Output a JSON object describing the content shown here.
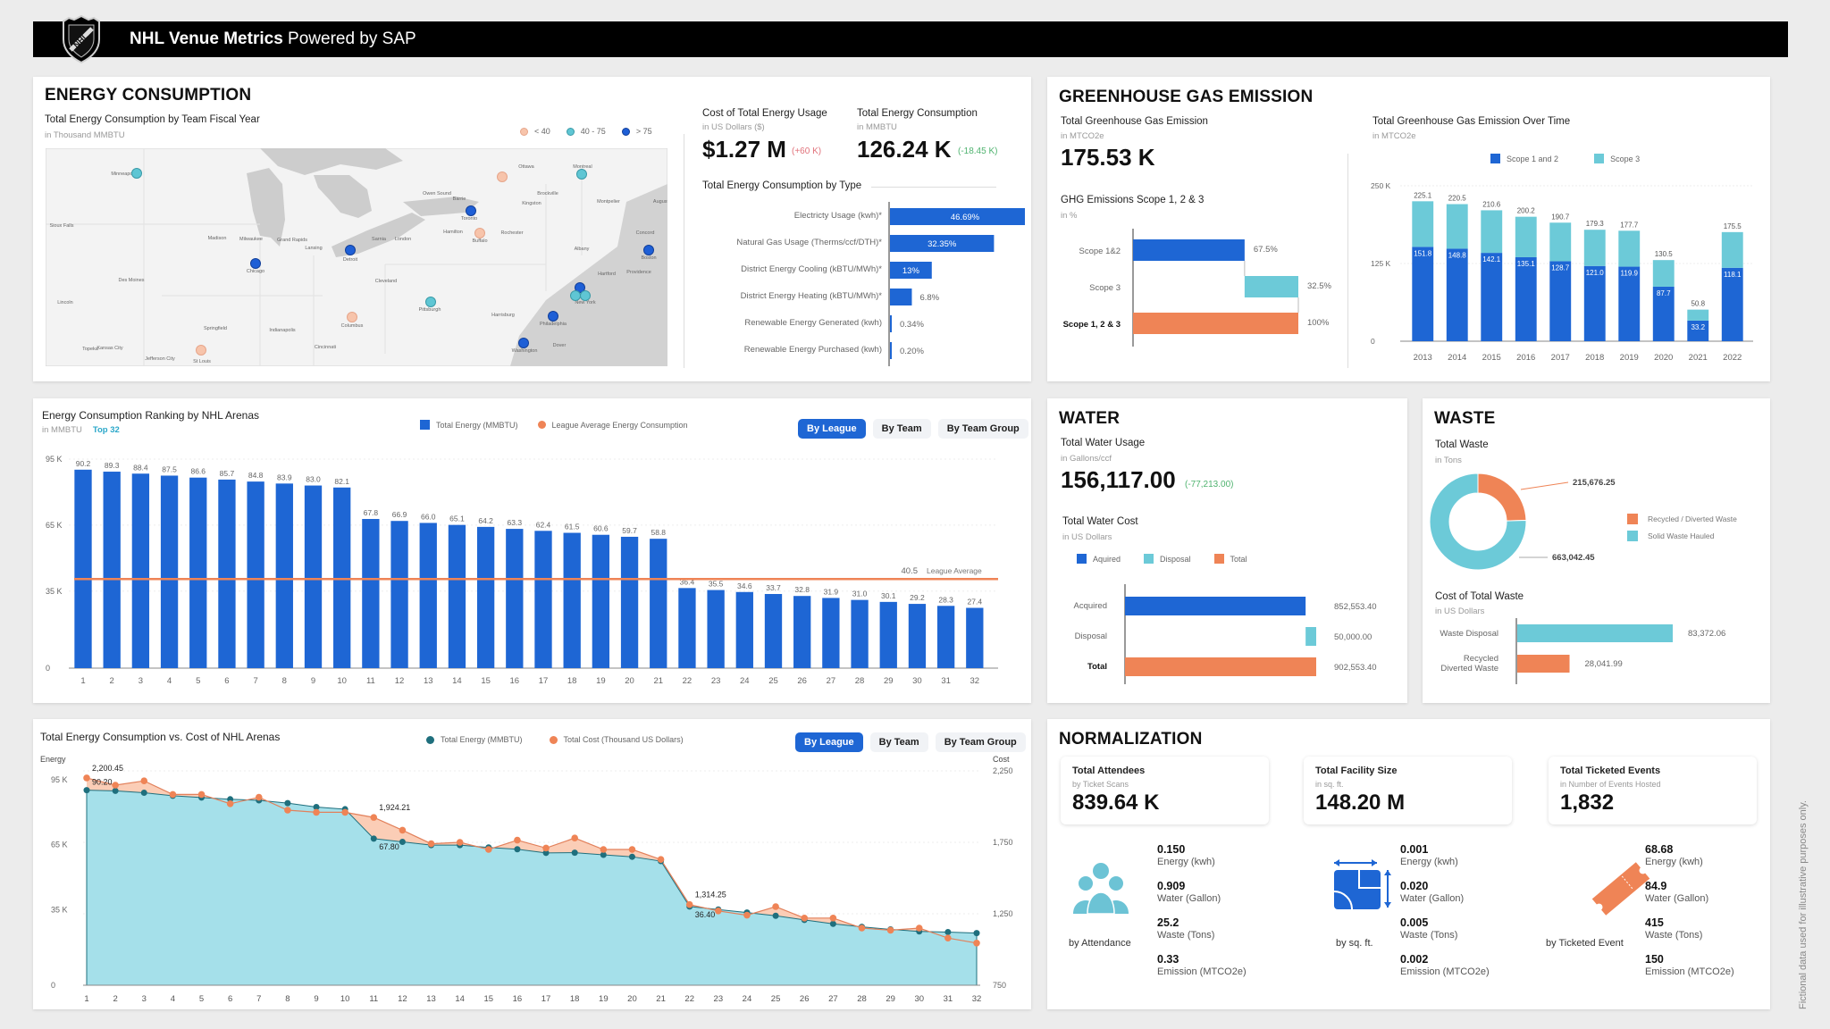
{
  "header": {
    "title_bold": "NHL Venue Metrics",
    "title_rest": " Powered by SAP",
    "logo": "nhl-shield-logo"
  },
  "energy": {
    "section_title": "ENERGY CONSUMPTION",
    "map": {
      "title": "Total Energy Consumption by Team Fiscal Year",
      "unit": "in Thousand MMBTU",
      "legend": [
        {
          "label": "< 40",
          "color": "#f7c4ab"
        },
        {
          "label": "40 - 75",
          "color": "#5fc6d4"
        },
        {
          "label": "> 75",
          "color": "#1e5fd6"
        }
      ],
      "markers": [
        {
          "city": "Minneapolis",
          "tier": "40 - 75"
        },
        {
          "city": "Chicago",
          "tier": "> 75"
        },
        {
          "city": "Detroit",
          "tier": "> 75"
        },
        {
          "city": "Toronto",
          "tier": "> 75"
        },
        {
          "city": "Buffalo",
          "tier": "< 40"
        },
        {
          "city": "Ottawa",
          "tier": "< 40"
        },
        {
          "city": "Montreal",
          "tier": "40 - 75"
        },
        {
          "city": "Boston",
          "tier": "> 75"
        },
        {
          "city": "New York",
          "tier": "> 75"
        },
        {
          "city": "New York",
          "tier": "40 - 75"
        },
        {
          "city": "New York",
          "tier": "40 - 75"
        },
        {
          "city": "Philadelphia",
          "tier": "> 75"
        },
        {
          "city": "Washington",
          "tier": "> 75"
        },
        {
          "city": "Pittsburgh",
          "tier": "40 - 75"
        },
        {
          "city": "Columbus",
          "tier": "< 40"
        },
        {
          "city": "St Louis",
          "tier": "< 40"
        }
      ],
      "place_labels": [
        "Minneapolis",
        "Sioux Falls",
        "Madison",
        "Milwaukee",
        "Grand Rapids",
        "Lansing",
        "Detroit",
        "Chicago",
        "Des Moines",
        "Lincoln",
        "Springfield",
        "Indianapolis",
        "Columbus",
        "Cincinnati",
        "Topeka",
        "Kansas City",
        "Jefferson City",
        "St Louis",
        "Toronto",
        "Hamilton",
        "Buffalo",
        "Rochester",
        "Ottawa",
        "Montreal",
        "Montpelier",
        "Augusta",
        "Concord",
        "Albany",
        "Boston",
        "Hartford",
        "Providence",
        "New York",
        "Philadelphia",
        "Harrisburg",
        "Pittsburgh",
        "Cleveland",
        "Washington",
        "Dover",
        "London",
        "Sarnia",
        "Barrie",
        "Kingston",
        "Brockville",
        "Owen Sound"
      ]
    },
    "cost_kpi": {
      "title": "Cost of Total Energy Usage",
      "unit": "in US Dollars ($)",
      "value": "$1.27 M",
      "delta": "(+60 K)"
    },
    "consumption_kpi": {
      "title": "Total Energy Consumption",
      "unit": "in MMBTU",
      "value": "126.24 K",
      "delta": "(-18.45 K)"
    },
    "by_type": {
      "title": "Total Energy Consumption by Type",
      "items": [
        {
          "label": "Electricty Usage (kwh)*",
          "value": 46.69,
          "display": "46.69%"
        },
        {
          "label": "Natural Gas Usage (Therms/ccf/DTH)*",
          "value": 32.35,
          "display": "32.35%"
        },
        {
          "label": "District Energy Cooling (kBTU/MWh)*",
          "value": 13,
          "display": "13%"
        },
        {
          "label": "District Energy Heating (kBTU/MWh)*",
          "value": 6.8,
          "display": "6.8%"
        },
        {
          "label": "Renewable Energy Generated (kwh)",
          "value": 0.34,
          "display": "0.34%"
        },
        {
          "label": "Renewable Energy Purchased (kwh)",
          "value": 0.2,
          "display": "0.20%"
        }
      ]
    }
  },
  "ghg": {
    "section_title": "GREENHOUSE GAS EMISSION",
    "kpi": {
      "title": "Total Greenhouse Gas Emission",
      "unit": "in MTCO2e",
      "value": "175.53 K"
    },
    "scopes": {
      "title": "GHG Emissions Scope 1, 2 & 3",
      "unit": "in %",
      "items": [
        {
          "label": "Scope 1&2",
          "value": 67.5,
          "display": "67.5%",
          "color": "#1e66d4"
        },
        {
          "label": "Scope 3",
          "value": 32.5,
          "display": "32.5%",
          "color": "#6ccad8"
        },
        {
          "label": "Scope 1, 2 & 3",
          "value": 100,
          "display": "100%",
          "color": "#ef8456"
        }
      ]
    }
  },
  "water": {
    "section_title": "WATER",
    "kpi": {
      "title": "Total Water Usage",
      "unit": "in Gallons/ccf",
      "value": "156,117.00",
      "delta": "(-77,213.00)"
    },
    "cost": {
      "title": "Total Water Cost",
      "unit": "in US Dollars",
      "legend": [
        {
          "label": "Aquired",
          "color": "#1e66d4"
        },
        {
          "label": "Disposal",
          "color": "#6ccad8"
        },
        {
          "label": "Total",
          "color": "#ef8456"
        }
      ],
      "items": [
        {
          "label": "Acquired",
          "value": 852553.4,
          "display": "852,553.40"
        },
        {
          "label": "Disposal",
          "value": 50000.0,
          "display": "50,000.00"
        },
        {
          "label": "Total",
          "value": 902553.4,
          "display": "902,553.40"
        }
      ]
    }
  },
  "waste": {
    "section_title": "WASTE",
    "total": {
      "title": "Total Waste",
      "unit": "in Tons"
    },
    "cost": {
      "title": "Cost of Total Waste",
      "unit": "in US Dollars",
      "items": [
        {
          "label": "Waste Disposal",
          "value": 83372.06,
          "display": "83,372.06",
          "color": "#6ccad8"
        },
        {
          "label": "Recycled Diverted Waste",
          "label_lines": [
            "Recycled",
            "Diverted Waste"
          ],
          "value": 28041.99,
          "display": "28,041.99",
          "color": "#ef8456"
        }
      ]
    }
  },
  "normalization": {
    "section_title": "NORMALIZATION",
    "cards": [
      {
        "title": "Total Attendees",
        "unit": "by Ticket Scans",
        "value": "839.64 K",
        "caption": "by Attendance",
        "icon": "people-group-icon",
        "metrics": [
          {
            "value": "0.150",
            "label": "Energy (kwh)"
          },
          {
            "value": "0.909",
            "label": "Water (Gallon)"
          },
          {
            "value": "25.2",
            "label": "Waste (Tons)"
          },
          {
            "value": "0.33",
            "label": "Emission (MTCO2e)"
          }
        ]
      },
      {
        "title": "Total Facility Size",
        "unit": "in sq. ft.",
        "value": "148.20 M",
        "caption": "by sq. ft.",
        "icon": "floor-plan-icon",
        "metrics": [
          {
            "value": "0.001",
            "label": "Energy (kwh)"
          },
          {
            "value": "0.020",
            "label": "Water (Gallon)"
          },
          {
            "value": "0.005",
            "label": "Waste (Tons)"
          },
          {
            "value": "0.002",
            "label": "Emission (MTCO2e)"
          }
        ]
      },
      {
        "title": "Total Ticketed Events",
        "unit": "in Number of Events Hosted",
        "value": "1,832",
        "caption": "by Ticketed Event",
        "icon": "ticket-icon",
        "metrics": [
          {
            "value": "68.68",
            "label": "Energy (kwh)"
          },
          {
            "value": "84.9",
            "label": "Water (Gallon)"
          },
          {
            "value": "415",
            "label": "Waste (Tons)"
          },
          {
            "value": "150",
            "label": "Emission (MTCO2e)"
          }
        ]
      }
    ]
  },
  "segmented": {
    "by_league": "By League",
    "by_team": "By Team",
    "by_team_group": "By Team Group"
  },
  "disclaimer": "Fictional data used for illustrative purposes only.",
  "chart_data": [
    {
      "id": "ghg_over_time",
      "type": "bar",
      "stacked": true,
      "title": "Total Greenhouse Gas Emission Over Time",
      "unit": "in MTCO2e",
      "categories": [
        "2013",
        "2014",
        "2015",
        "2016",
        "2017",
        "2018",
        "2019",
        "2020",
        "2021",
        "2022"
      ],
      "series": [
        {
          "name": "Scope 1 and 2",
          "color": "#1e66d4",
          "values": [
            151.8,
            148.8,
            142.1,
            135.1,
            128.7,
            121.0,
            119.9,
            87.7,
            33.2,
            118.1
          ]
        },
        {
          "name": "Scope 3",
          "color": "#6ccad8",
          "values": [
            73.3,
            71.7,
            68.5,
            65.1,
            62.0,
            58.3,
            57.8,
            42.8,
            17.6,
            57.4
          ]
        }
      ],
      "totals": [
        225.1,
        220.5,
        210.6,
        200.2,
        190.7,
        179.3,
        177.7,
        130.5,
        50.8,
        175.5
      ],
      "yticks": [
        "0",
        "125 K",
        "250 K"
      ],
      "ylim": [
        0,
        250
      ],
      "legend": "top"
    },
    {
      "id": "energy_ranking",
      "type": "bar",
      "title": "Energy Consumption Ranking by NHL Arenas",
      "unit": "in MMBTU",
      "filter_tag": "Top 32",
      "categories": [
        "1",
        "2",
        "3",
        "4",
        "5",
        "6",
        "7",
        "8",
        "9",
        "10",
        "11",
        "12",
        "13",
        "14",
        "15",
        "16",
        "17",
        "18",
        "19",
        "20",
        "21",
        "22",
        "23",
        "24",
        "25",
        "26",
        "27",
        "28",
        "29",
        "30",
        "31",
        "32"
      ],
      "series": [
        {
          "name": "Total Energy (MMBTU)",
          "color": "#1e66d4",
          "values": [
            90.2,
            89.3,
            88.4,
            87.5,
            86.6,
            85.7,
            84.8,
            83.9,
            83.0,
            82.1,
            67.8,
            66.9,
            66.0,
            65.1,
            64.2,
            63.3,
            62.4,
            61.5,
            60.6,
            59.7,
            58.8,
            36.4,
            35.5,
            34.6,
            33.7,
            32.8,
            31.9,
            31.0,
            30.1,
            29.2,
            28.3,
            27.4
          ]
        }
      ],
      "reference_line": {
        "name": "League Average Energy Consumption",
        "label": "League Average",
        "value": 40.5,
        "color": "#ef8456"
      },
      "yticks": [
        "0",
        "35 K",
        "65 K",
        "95 K"
      ],
      "ylim": [
        0,
        95
      ],
      "legend": "top-right"
    },
    {
      "id": "energy_vs_cost",
      "type": "area",
      "title": "Total Energy Consumption vs. Cost of NHL Arenas",
      "x": [
        "1",
        "2",
        "3",
        "4",
        "5",
        "6",
        "7",
        "8",
        "9",
        "10",
        "11",
        "12",
        "13",
        "14",
        "15",
        "16",
        "17",
        "18",
        "19",
        "20",
        "21",
        "22",
        "23",
        "24",
        "25",
        "26",
        "27",
        "28",
        "29",
        "30",
        "31",
        "32"
      ],
      "series": [
        {
          "name": "Total Energy (MMBTU)",
          "axis": "left",
          "color": "#1f6f7d",
          "fill": "#a5e0ea",
          "values": [
            90.2,
            89.9,
            89.0,
            87.6,
            86.8,
            86.0,
            85.5,
            84.2,
            82.4,
            81.4,
            67.8,
            66.3,
            64.8,
            64.8,
            63.7,
            62.9,
            61.2,
            61.3,
            60.3,
            59.4,
            57.4,
            36.4,
            35.0,
            33.6,
            32.1,
            30.2,
            28.4,
            27.0,
            25.8,
            24.9,
            24.6,
            24.1
          ],
          "labels": {
            "1": "90.20",
            "11": "67.80",
            "22": "36.40"
          }
        },
        {
          "name": "Total Cost (Thousand US Dollars)",
          "axis": "right",
          "color": "#ef8456",
          "fill": "#fbcdb6",
          "values": [
            2200.45,
            2150,
            2180,
            2085,
            2085,
            2020,
            2065,
            1975,
            1960,
            1960,
            1924.21,
            1835,
            1740,
            1750,
            1700,
            1765,
            1710,
            1780,
            1700,
            1700,
            1630,
            1314.25,
            1270,
            1240,
            1300,
            1220,
            1220,
            1150,
            1135,
            1150,
            1080,
            1045
          ],
          "labels": {
            "1": "2,200.45",
            "11": "1,924.21",
            "22": "1,314.25"
          }
        }
      ],
      "left_axis": {
        "label": "Energy",
        "ticks": [
          "0",
          "35 K",
          "65 K",
          "95 K"
        ],
        "range": [
          0,
          95
        ]
      },
      "right_axis": {
        "label": "Cost",
        "ticks": [
          "750",
          "1,250",
          "1,750",
          "2,250"
        ],
        "range": [
          750,
          2250
        ]
      },
      "legend": "top"
    },
    {
      "id": "waste_donut",
      "type": "pie",
      "donut": true,
      "title": "Total Waste",
      "unit": "in Tons",
      "slices": [
        {
          "name": "Recycled / Diverted Waste",
          "value": 215676.25,
          "display": "215,676.25",
          "color": "#ef8456"
        },
        {
          "name": "Solid Waste Hauled",
          "value": 663042.45,
          "display": "663,042.45",
          "color": "#6ccad8"
        }
      ],
      "legend": "right"
    }
  ]
}
